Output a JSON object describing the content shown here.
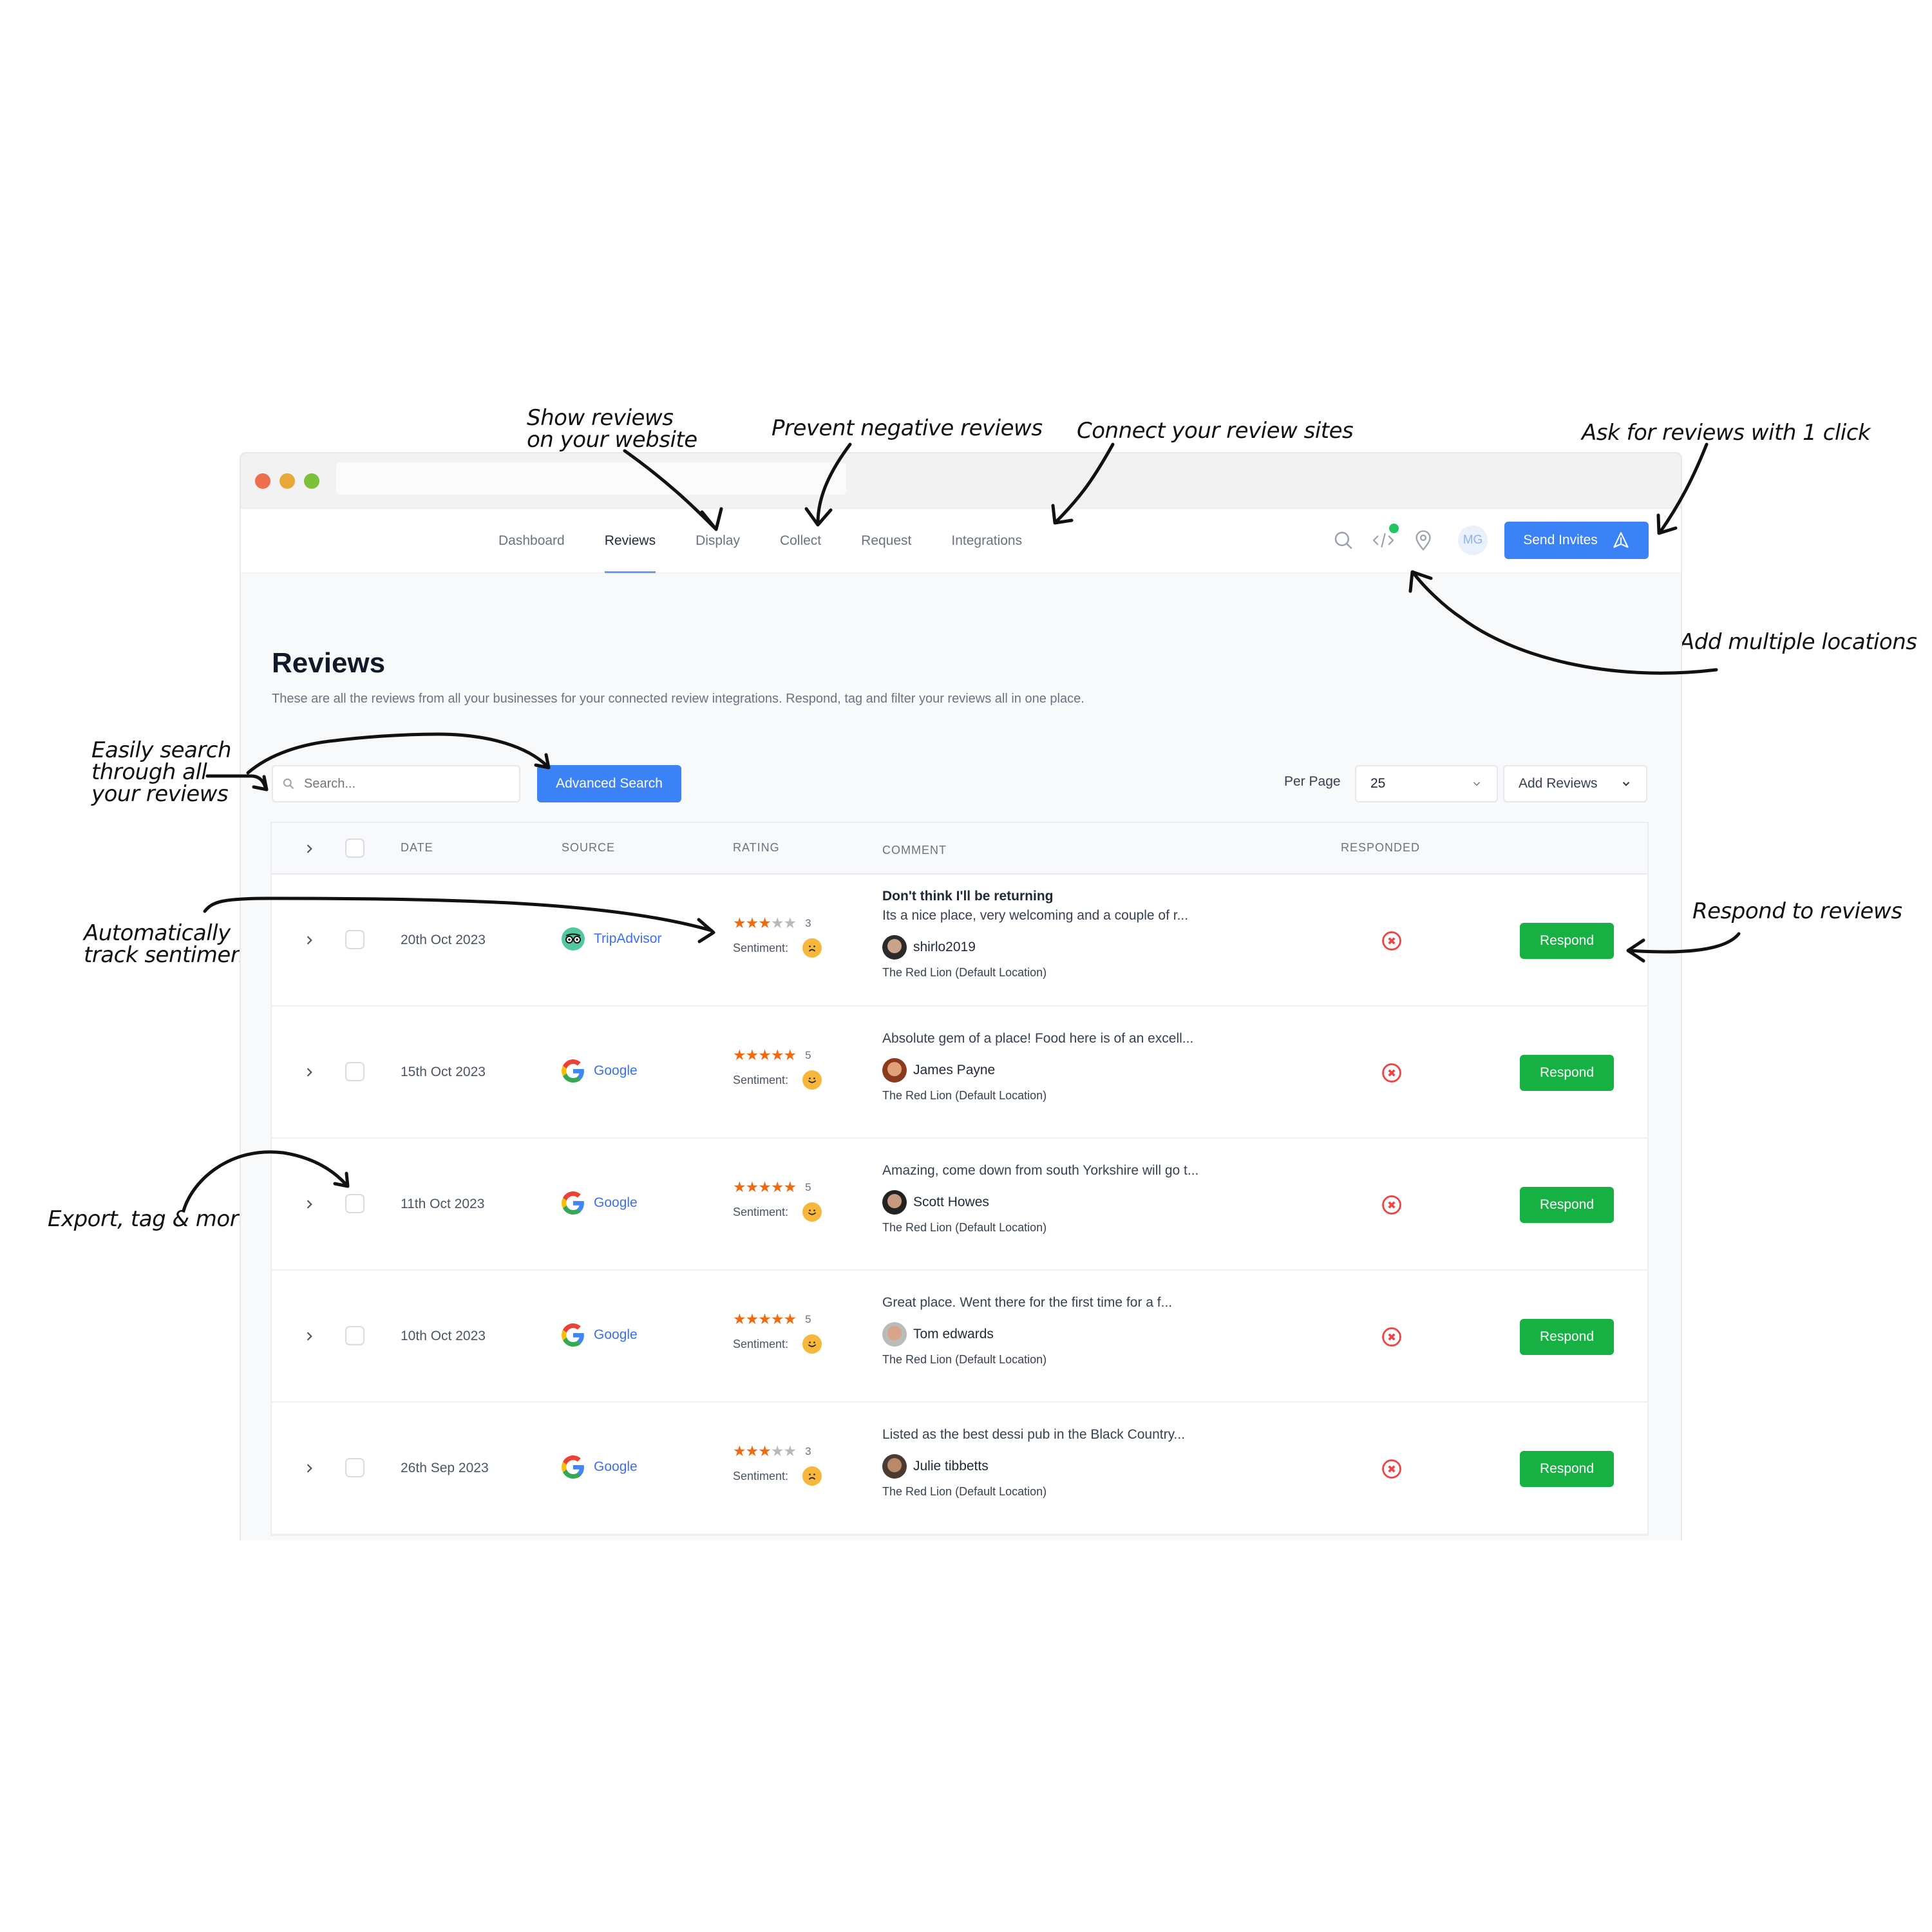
{
  "annotations": {
    "show_reviews": "Show reviews\non your website",
    "prevent_negative": "Prevent negative reviews",
    "connect_sites": "Connect your review sites",
    "ask_for_reviews": "Ask for reviews with 1 click",
    "add_locations": "Add multiple locations",
    "easily_search": "Easily search\nthrough all\nyour reviews",
    "track_sentiment": "Automatically\ntrack sentiment",
    "respond_reviews": "Respond to reviews",
    "export_tag": "Export, tag & more"
  },
  "nav": {
    "tabs": [
      {
        "label": "Dashboard",
        "active": false
      },
      {
        "label": "Reviews",
        "active": true
      },
      {
        "label": "Display",
        "active": false
      },
      {
        "label": "Collect",
        "active": false
      },
      {
        "label": "Request",
        "active": false
      },
      {
        "label": "Integrations",
        "active": false
      }
    ],
    "icons": [
      "search-icon",
      "code-icon",
      "location-pin-icon"
    ],
    "user_initials": "MG",
    "send_invites_label": "Send Invites"
  },
  "page": {
    "title": "Reviews",
    "description": "These are all the reviews from all your businesses for your connected review integrations. Respond, tag and filter your reviews all in one place."
  },
  "toolbar": {
    "search_placeholder": "Search...",
    "advanced_search_label": "Advanced Search",
    "per_page_label": "Per Page",
    "per_page_value": "25",
    "add_reviews_label": "Add Reviews"
  },
  "table": {
    "headers": {
      "date": "DATE",
      "source": "SOURCE",
      "rating": "RATING",
      "comment": "COMMENT",
      "responded": "RESPONDED"
    },
    "sentiment_label": "Sentiment:",
    "respond_label": "Respond",
    "rows": [
      {
        "date": "20th Oct 2023",
        "source": "TripAdvisor",
        "rating": 3,
        "rating_text": "3",
        "sentiment": "negative",
        "title": "Don't think I'll be returning",
        "comment": "Its a nice place, very welcoming and a couple of r...",
        "author": "shirlo2019",
        "location": "The Red Lion (Default Location)",
        "responded": false
      },
      {
        "date": "15th Oct 2023",
        "source": "Google",
        "rating": 5,
        "rating_text": "5",
        "sentiment": "positive",
        "title": "",
        "comment": "Absolute gem of a place! Food here is of an excell...",
        "author": "James Payne",
        "location": "The Red Lion (Default Location)",
        "responded": false
      },
      {
        "date": "11th Oct 2023",
        "source": "Google",
        "rating": 5,
        "rating_text": "5",
        "sentiment": "positive",
        "title": "",
        "comment": "Amazing, come down from south Yorkshire will go t...",
        "author": "Scott Howes",
        "location": "The Red Lion (Default Location)",
        "responded": false
      },
      {
        "date": "10th Oct 2023",
        "source": "Google",
        "rating": 5,
        "rating_text": "5",
        "sentiment": "positive",
        "title": "",
        "comment": "Great place. Went there for the first time for a f...",
        "author": "Tom edwards",
        "location": "The Red Lion (Default Location)",
        "responded": false
      },
      {
        "date": "26th Sep 2023",
        "source": "Google",
        "rating": 3,
        "rating_text": "3",
        "sentiment": "negative",
        "title": "",
        "comment": "Listed as the best dessi pub in the Black Country...",
        "author": "Julie tibbetts",
        "location": "The Red Lion (Default Location)",
        "responded": false
      }
    ]
  },
  "colors": {
    "primary": "#3b82f6",
    "respond_green": "#16b043",
    "star_on": "#f06a0f",
    "star_off": "#b9b9b9",
    "not_responded_red": "#ef4444",
    "sentiment_face": "#f6b73c"
  }
}
